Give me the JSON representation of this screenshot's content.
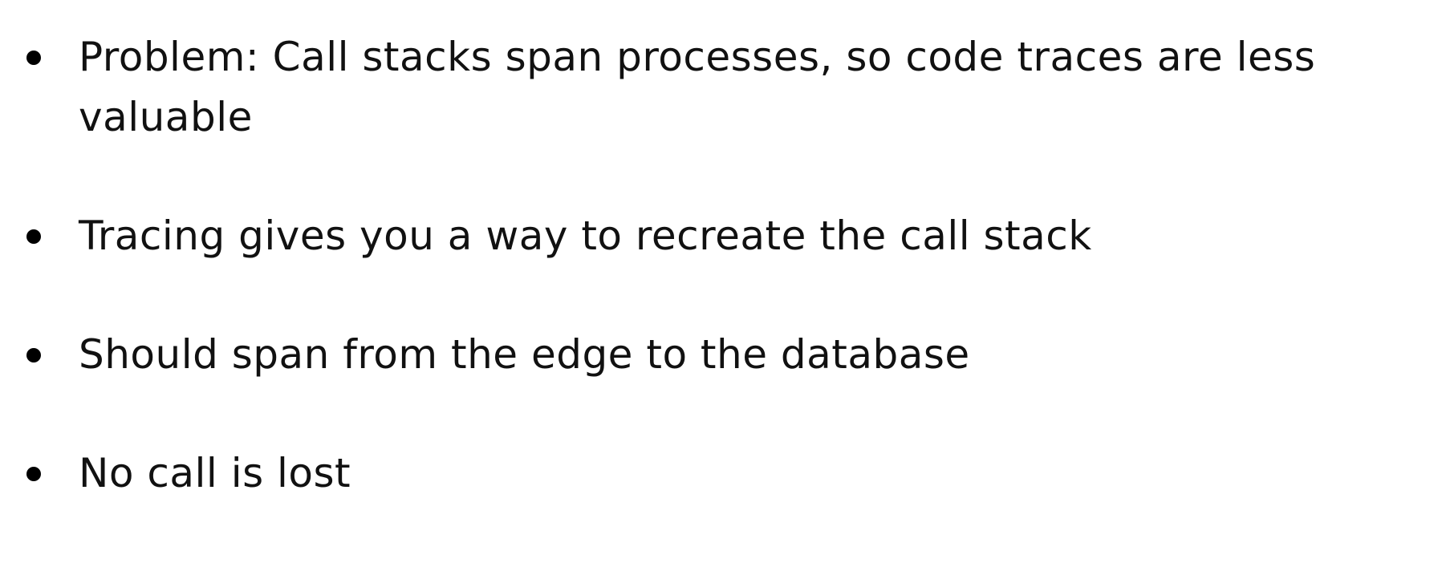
{
  "slide": {
    "bullets": [
      {
        "text": "Problem: Call stacks span processes, so code traces are less valuable"
      },
      {
        "text": "Tracing gives you a way to recreate the call stack"
      },
      {
        "text": "Should span from the edge to the database"
      },
      {
        "text": "No call is lost"
      }
    ]
  },
  "colors": {
    "background": "#ffffff",
    "text": "#111111",
    "bullet": "#000000"
  },
  "icons": {
    "bullet": "bullet-icon"
  }
}
